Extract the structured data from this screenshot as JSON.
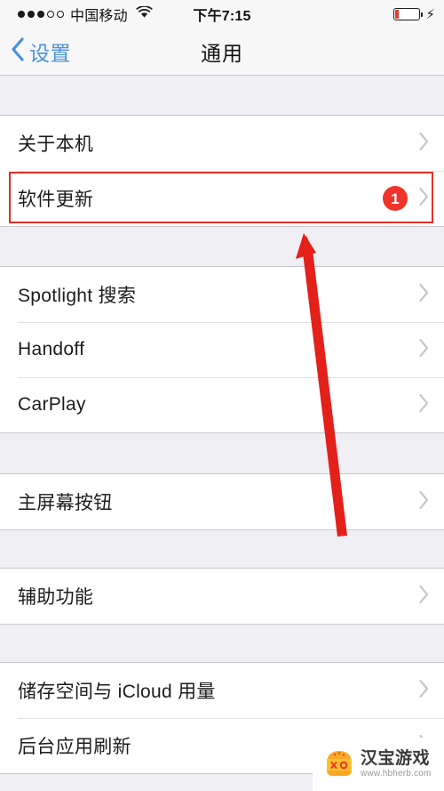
{
  "status_bar": {
    "signal_filled": 3,
    "signal_total": 5,
    "carrier": "中国移动",
    "wifi_icon": "wifi-icon",
    "time": "下午7:15",
    "battery_icon": "battery-icon",
    "battery_level_percent": 13,
    "charging_icon": "lightning-bolt-icon"
  },
  "nav_bar": {
    "back_icon": "chevron-left-icon",
    "back_label": "设置",
    "title": "通用"
  },
  "list": {
    "groups": [
      {
        "rows": [
          {
            "label": "关于本机",
            "badge": "",
            "chevron": "chevron-right-icon"
          },
          {
            "label": "软件更新",
            "badge": "1",
            "chevron": "chevron-right-icon"
          }
        ]
      },
      {
        "rows": [
          {
            "label": "Spotlight 搜索",
            "badge": "",
            "chevron": "chevron-right-icon"
          },
          {
            "label": "Handoff",
            "badge": "",
            "chevron": "chevron-right-icon"
          },
          {
            "label": "CarPlay",
            "badge": "",
            "chevron": "chevron-right-icon"
          }
        ]
      },
      {
        "rows": [
          {
            "label": "主屏幕按钮",
            "badge": "",
            "chevron": "chevron-right-icon"
          }
        ]
      },
      {
        "rows": [
          {
            "label": "辅助功能",
            "badge": "",
            "chevron": "chevron-right-icon"
          }
        ]
      },
      {
        "rows": [
          {
            "label": "储存空间与 iCloud 用量",
            "badge": "",
            "chevron": "chevron-right-icon"
          },
          {
            "label": "后台应用刷新",
            "badge": "",
            "chevron": "chevron-right-icon"
          }
        ]
      }
    ]
  },
  "annotations": {
    "highlight_target": "软件更新",
    "arrow_icon": "red-arrow-pointing-up",
    "color": "#e03227"
  },
  "watermark": {
    "logo_icon": "burger-logo-icon",
    "title": "汉宝游戏",
    "url": "www.hbherb.com"
  },
  "colors": {
    "accent_blue": "#4a90d9",
    "badge_red": "#f0342b",
    "annotation_red": "#e03227",
    "background_gray": "#efeff4",
    "row_white": "#ffffff",
    "chevron_gray": "#c7c7cc"
  }
}
